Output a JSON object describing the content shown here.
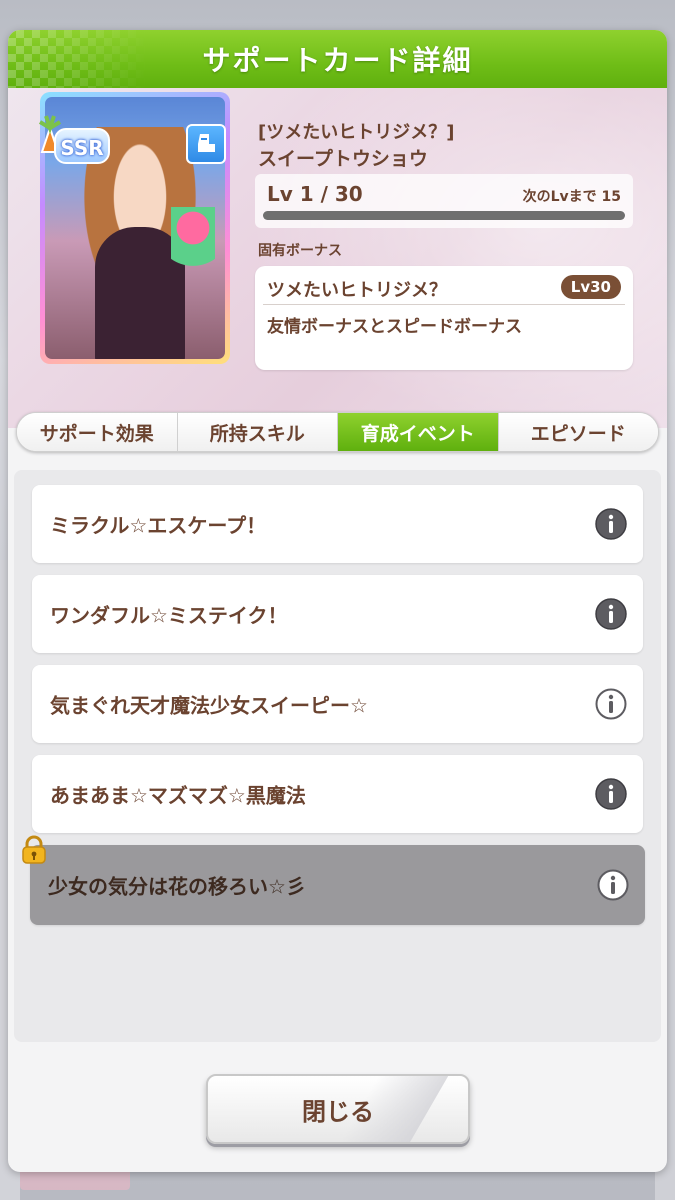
{
  "dialog": {
    "title": "サポートカード詳細"
  },
  "card": {
    "rarity": "SSR",
    "name_line1": "[ツメたいヒトリジメ？]",
    "name_line2": "スイープトウショウ",
    "level_text": "Lv 1 / 30",
    "next_level_text": "次のLvまで 15",
    "level_progress": 0.0,
    "type_icon": "speed-boot-icon"
  },
  "unique_bonus": {
    "label": "固有ボーナス",
    "title": "ツメたいヒトリジメ？",
    "unlock_level": "Lv30",
    "description": "友情ボーナスとスピードボーナス"
  },
  "tabs": [
    {
      "label": "サポート効果",
      "active": false
    },
    {
      "label": "所持スキル",
      "active": false
    },
    {
      "label": "育成イベント",
      "active": true
    },
    {
      "label": "エピソード",
      "active": false
    }
  ],
  "events": [
    {
      "label": "ミラクル☆エスケープ！",
      "info_style": "dark"
    },
    {
      "label": "ワンダフル☆ミステイク！",
      "info_style": "dark"
    },
    {
      "label": "気まぐれ天才魔法少女スイーピー☆",
      "info_style": "light"
    },
    {
      "label": "あまあま☆マズマズ☆黒魔法",
      "info_style": "dark"
    },
    {
      "label": "少女の気分は花の移ろい☆彡",
      "info_style": "light",
      "locked": true
    }
  ],
  "close_button": {
    "label": "閉じる"
  },
  "colors": {
    "accent_green": "#6fbd17",
    "text_brown": "#6b4330",
    "locked_row": "#9a999c"
  }
}
